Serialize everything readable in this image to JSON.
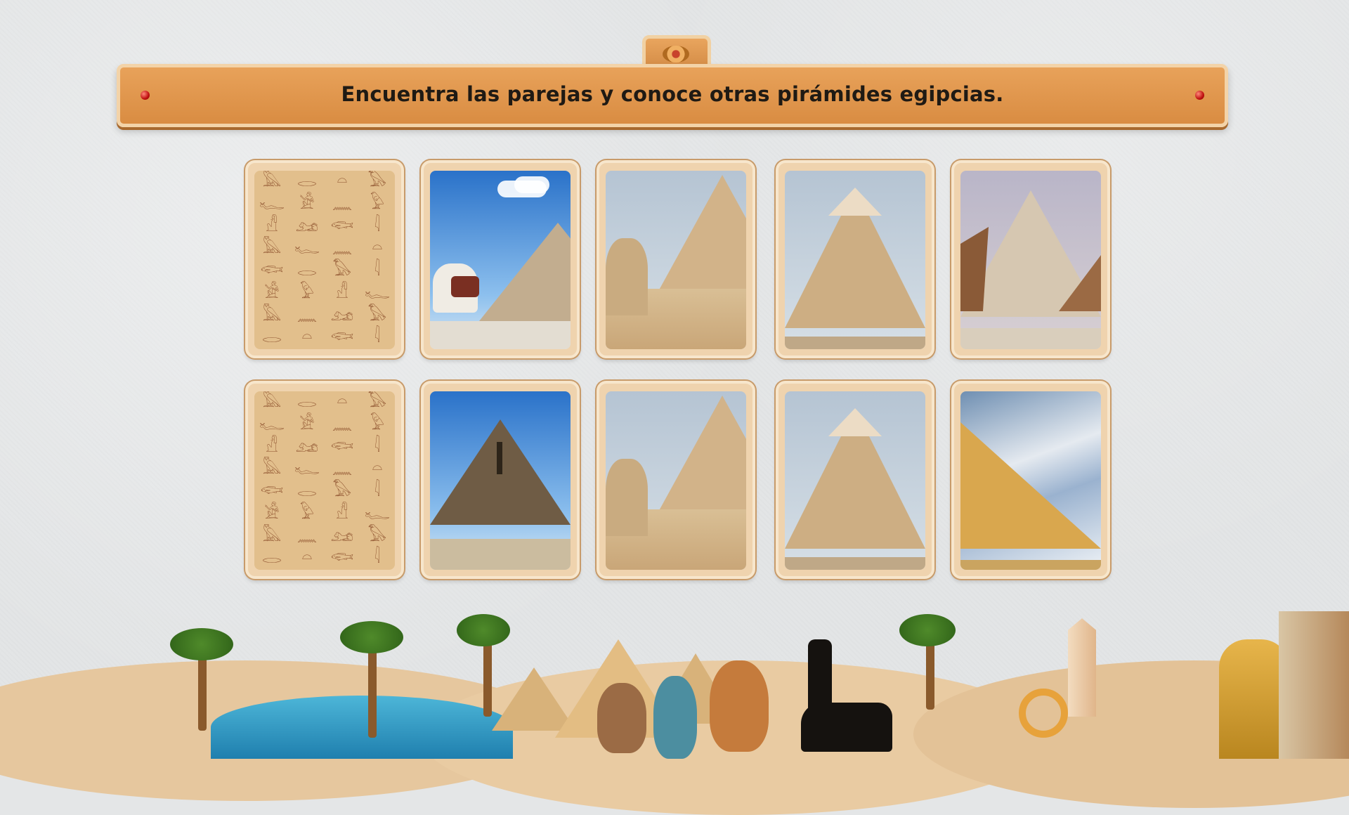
{
  "game": {
    "instruction": "Encuentra las parejas y conoce otras pirámides egipcias."
  },
  "board": {
    "rows": 2,
    "columns": 5,
    "cards": [
      {
        "state": "face-down",
        "picture": "hieroglyph-card-back"
      },
      {
        "state": "face-up",
        "picture": "step-pyramid-with-camel"
      },
      {
        "state": "face-up",
        "picture": "sphinx-and-pyramid"
      },
      {
        "state": "face-up",
        "picture": "pyramid-of-khafre"
      },
      {
        "state": "face-up",
        "picture": "bent-pyramid"
      },
      {
        "state": "face-down",
        "picture": "hieroglyph-card-back"
      },
      {
        "state": "face-up",
        "picture": "pyramid-of-menkaure"
      },
      {
        "state": "face-up",
        "picture": "sphinx-and-pyramid"
      },
      {
        "state": "face-up",
        "picture": "pyramid-of-khafre"
      },
      {
        "state": "face-up",
        "picture": "great-pyramid-cloudy-sky"
      }
    ]
  },
  "icons": {
    "banner_emblem": "scarab-icon",
    "card_back_pattern": "hieroglyphs",
    "rivet": "rivet-icon"
  },
  "colors": {
    "banner": "#dd9148",
    "card_frame": "#efd3ae",
    "background": "#e3e5e6"
  }
}
